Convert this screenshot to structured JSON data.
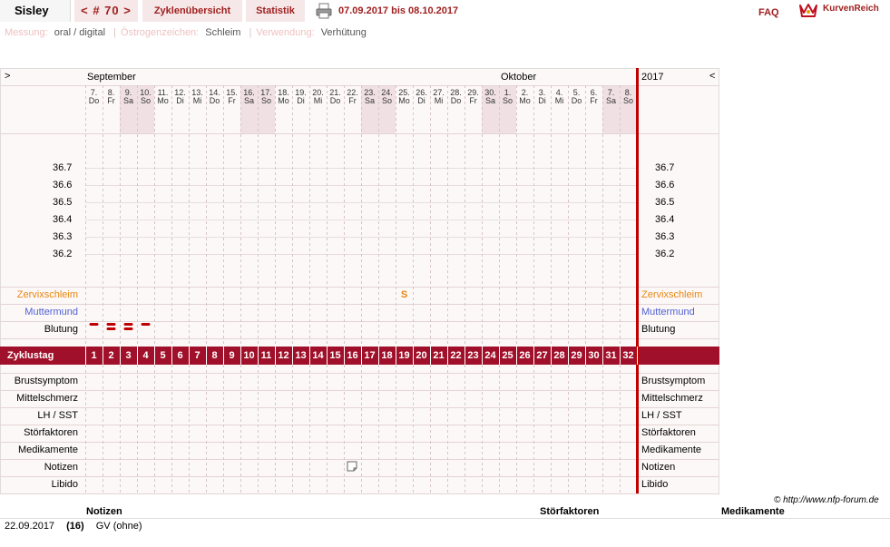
{
  "header": {
    "title": "Sisley",
    "nav": "< # 70 >",
    "cycle_overview": "Zyklenübersicht",
    "statistics": "Statistik",
    "date_range": "07.09.2017 bis 08.10.2017",
    "faq": "FAQ",
    "logo": "KurvenReich"
  },
  "info": {
    "measurement_label": "Messung:",
    "measurement_value": "oral / digital",
    "estrogen_label": "Östrogenzeichen:",
    "estrogen_value": "Schleim",
    "usage_label": "Verwendung:",
    "usage_value": "Verhütung"
  },
  "chart_header": {
    "left_arrow": ">",
    "right_arrow": "<",
    "month1": "September",
    "month2": "Oktober",
    "year": "2017"
  },
  "days": [
    {
      "d": "7.",
      "w": "Do",
      "we": false
    },
    {
      "d": "8.",
      "w": "Fr",
      "we": false
    },
    {
      "d": "9.",
      "w": "Sa",
      "we": true
    },
    {
      "d": "10.",
      "w": "So",
      "we": true
    },
    {
      "d": "11.",
      "w": "Mo",
      "we": false
    },
    {
      "d": "12.",
      "w": "Di",
      "we": false
    },
    {
      "d": "13.",
      "w": "Mi",
      "we": false
    },
    {
      "d": "14.",
      "w": "Do",
      "we": false
    },
    {
      "d": "15.",
      "w": "Fr",
      "we": false
    },
    {
      "d": "16.",
      "w": "Sa",
      "we": true
    },
    {
      "d": "17.",
      "w": "So",
      "we": true
    },
    {
      "d": "18.",
      "w": "Mo",
      "we": false
    },
    {
      "d": "19.",
      "w": "Di",
      "we": false
    },
    {
      "d": "20.",
      "w": "Mi",
      "we": false
    },
    {
      "d": "21.",
      "w": "Do",
      "we": false
    },
    {
      "d": "22.",
      "w": "Fr",
      "we": false
    },
    {
      "d": "23.",
      "w": "Sa",
      "we": true
    },
    {
      "d": "24.",
      "w": "So",
      "we": true
    },
    {
      "d": "25.",
      "w": "Mo",
      "we": false
    },
    {
      "d": "26.",
      "w": "Di",
      "we": false
    },
    {
      "d": "27.",
      "w": "Mi",
      "we": false
    },
    {
      "d": "28.",
      "w": "Do",
      "we": false
    },
    {
      "d": "29.",
      "w": "Fr",
      "we": false
    },
    {
      "d": "30.",
      "w": "Sa",
      "we": true
    },
    {
      "d": "1.",
      "w": "So",
      "we": true
    },
    {
      "d": "2.",
      "w": "Mo",
      "we": false
    },
    {
      "d": "3.",
      "w": "Di",
      "we": false
    },
    {
      "d": "4.",
      "w": "Mi",
      "we": false
    },
    {
      "d": "5.",
      "w": "Do",
      "we": false
    },
    {
      "d": "6.",
      "w": "Fr",
      "we": false
    },
    {
      "d": "7.",
      "w": "Sa",
      "we": true
    },
    {
      "d": "8.",
      "w": "So",
      "we": true
    }
  ],
  "temperatures": [
    "36.7",
    "36.6",
    "36.5",
    "36.4",
    "36.3",
    "36.2"
  ],
  "rows": {
    "cervix": "Zervixschleim",
    "cervix_color": "#e8860f",
    "cervix_mark": "S",
    "cervix_mark_day": 19,
    "muttermund": "Muttermund",
    "muttermund_color": "#5060d0",
    "blutung": "Blutung",
    "bleeding": [
      {
        "day": 1,
        "level": 1
      },
      {
        "day": 2,
        "level": 2
      },
      {
        "day": 3,
        "level": 2
      },
      {
        "day": 4,
        "level": 1
      }
    ],
    "cycle_day_label": "Zyklustag",
    "symptoms": [
      "Brustsymptom",
      "Mittelschmerz",
      "LH / SST",
      "Störfaktoren",
      "Medikamente",
      "Notizen",
      "Libido"
    ],
    "note_icon_day": 16
  },
  "accent": "#a0102a",
  "copyright": "© http://www.nfp-forum.de",
  "notes": {
    "col1": "Notizen",
    "col2": "Störfaktoren",
    "col3": "Medikamente",
    "entry_date": "22.09.2017",
    "entry_day": "(16)",
    "entry_text": "GV (ohne)"
  }
}
